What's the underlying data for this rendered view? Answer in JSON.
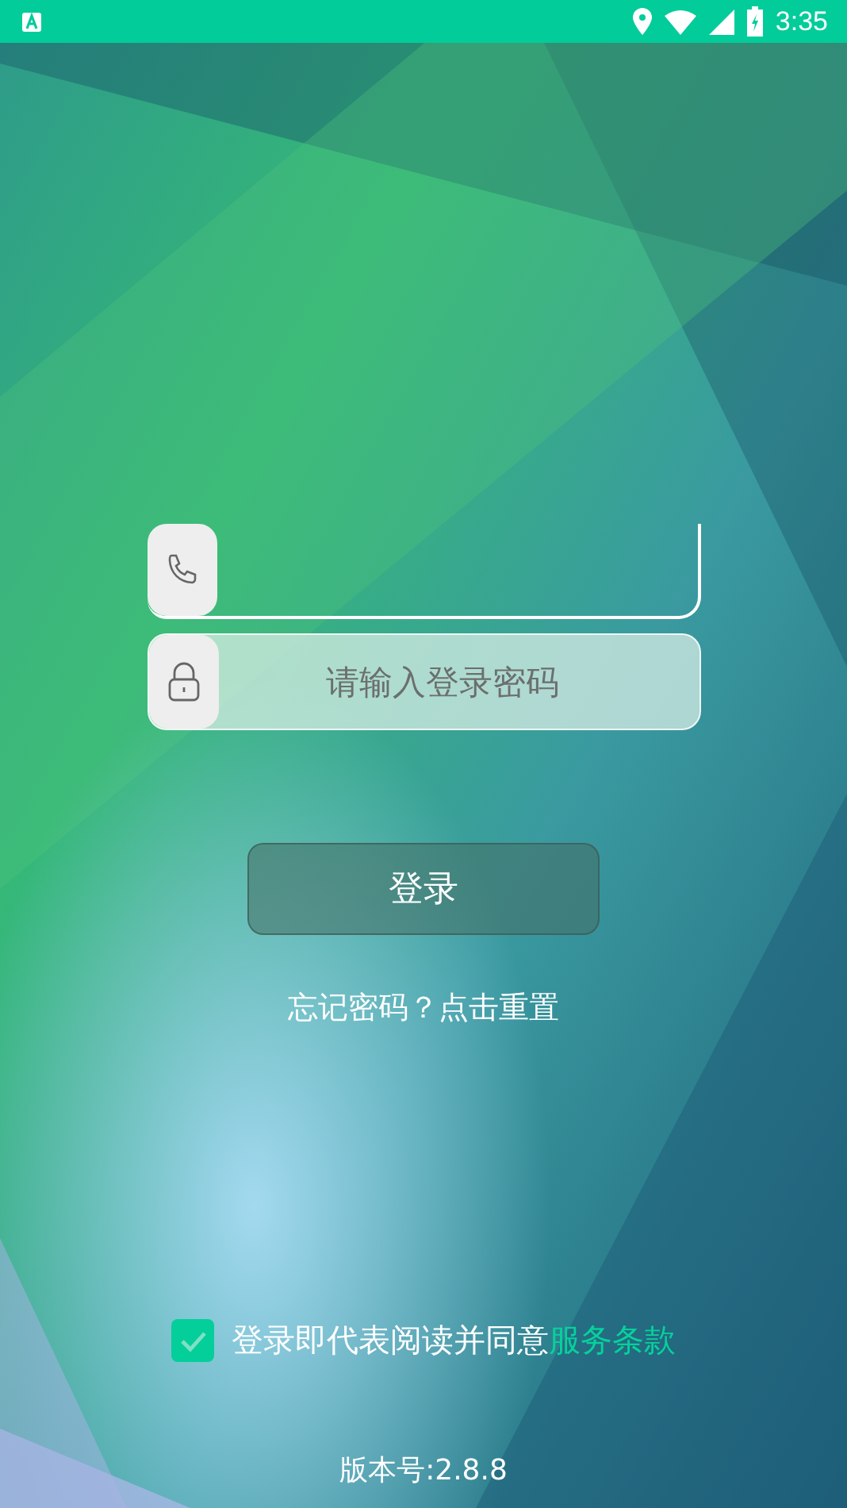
{
  "status_bar": {
    "time": "3:35"
  },
  "fields": [
    {
      "kind": "phone"
    },
    {
      "kind": "password",
      "placeholder": "请输入登录密码"
    }
  ],
  "login_button": {
    "label": "登录"
  },
  "forgot_link": {
    "label": "忘记密码？点击重置"
  },
  "agreement": {
    "checked": true,
    "text": "登录即代表阅读并同意",
    "link": "服务条款"
  },
  "version": "版本号:2.8.8"
}
